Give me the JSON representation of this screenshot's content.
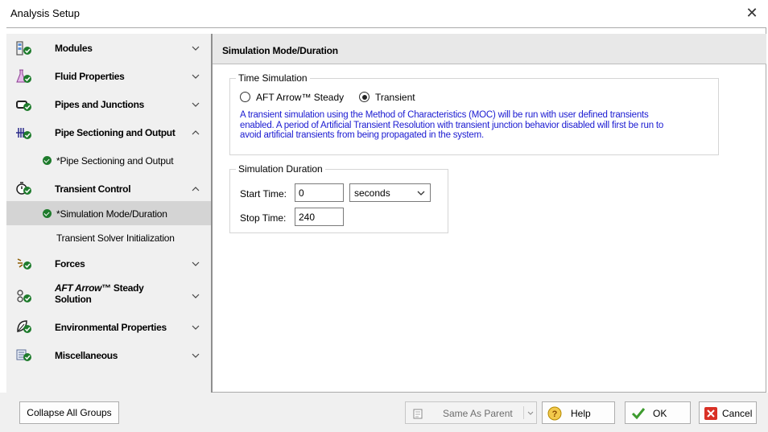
{
  "window": {
    "title": "Analysis Setup"
  },
  "sidebar": {
    "groups": [
      {
        "label": "Modules",
        "icon": "modules-icon",
        "expanded": false
      },
      {
        "label": "Fluid Properties",
        "icon": "flask-icon",
        "expanded": false
      },
      {
        "label": "Pipes and Junctions",
        "icon": "pipe-icon",
        "expanded": false
      },
      {
        "label": "Pipe Sectioning and Output",
        "icon": "pipe-sectioning-icon",
        "expanded": true,
        "items": [
          {
            "label": "*Pipe Sectioning and Output"
          }
        ]
      },
      {
        "label": "Transient Control",
        "icon": "stopwatch-icon",
        "expanded": true,
        "items": [
          {
            "label": "*Simulation Mode/Duration",
            "selected": true
          },
          {
            "label": "Transient Solver Initialization"
          }
        ]
      },
      {
        "label": "Forces",
        "icon": "forces-icon",
        "expanded": false
      },
      {
        "label": "AFT Arrow",
        "label_suffix": "™ Steady",
        "label_line2": "Solution",
        "icon": "steady-solution-icon",
        "expanded": false
      },
      {
        "label": "Environmental Properties",
        "icon": "leaf-icon",
        "expanded": false
      },
      {
        "label": "Miscellaneous",
        "icon": "misc-icon",
        "expanded": false
      }
    ],
    "collapse_all_label": "Collapse All Groups"
  },
  "panel": {
    "title": "Simulation Mode/Duration",
    "time_simulation": {
      "legend": "Time Simulation",
      "option_steady": "AFT Arrow™ Steady",
      "option_transient": "Transient",
      "selected": "Transient",
      "description_lines": [
        "A transient simulation using the Method of Characteristics (MOC) will be run with user defined transients",
        "enabled. A period of Artificial Transient Resolution with transient junction behavior disabled will first be run to",
        "avoid artificial transients from being propagated in the system."
      ]
    },
    "duration": {
      "legend": "Simulation Duration",
      "start_label": "Start Time:",
      "start_value": "0",
      "units": "seconds",
      "stop_label": "Stop Time:",
      "stop_value": "240"
    }
  },
  "footer": {
    "same_as_parent": "Same As Parent",
    "help": "Help",
    "ok": "OK",
    "cancel": "Cancel"
  },
  "colors": {
    "status_check": "#1e7b2c",
    "description_text": "#1a1ad1",
    "selected_row": "#d4d4d4"
  }
}
